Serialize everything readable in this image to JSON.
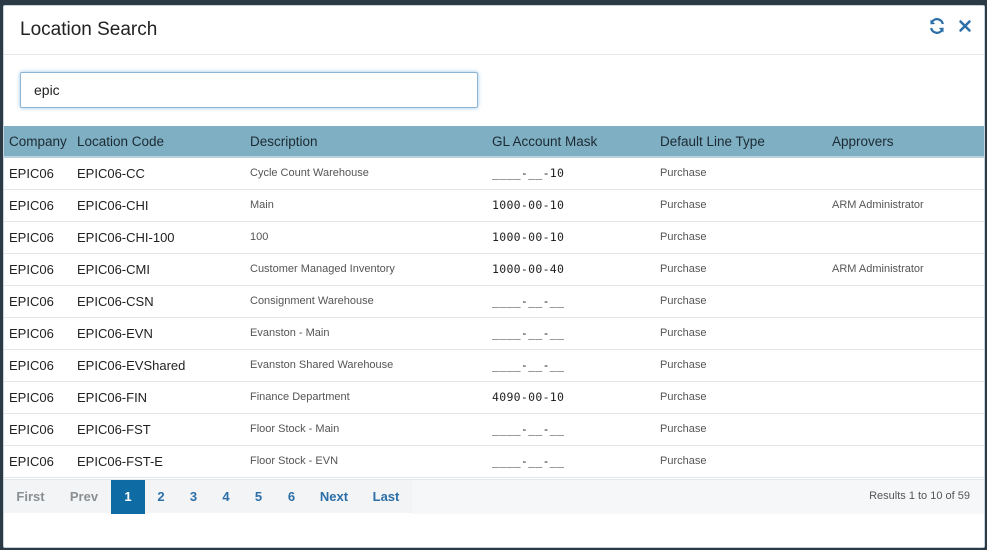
{
  "dialog": {
    "title": "Location Search"
  },
  "search": {
    "value": "epic"
  },
  "table": {
    "columns": [
      "Company",
      "Location Code",
      "Description",
      "GL Account Mask",
      "Default Line Type",
      "Approvers"
    ],
    "rows": [
      [
        "EPIC06",
        "EPIC06-CC",
        "Cycle Count Warehouse",
        "____-__-10",
        "Purchase",
        ""
      ],
      [
        "EPIC06",
        "EPIC06-CHI",
        "Main",
        "1000-00-10",
        "Purchase",
        "ARM Administrator"
      ],
      [
        "EPIC06",
        "EPIC06-CHI-100",
        "100",
        "1000-00-10",
        "Purchase",
        ""
      ],
      [
        "EPIC06",
        "EPIC06-CMI",
        "Customer Managed Inventory",
        "1000-00-40",
        "Purchase",
        "ARM Administrator"
      ],
      [
        "EPIC06",
        "EPIC06-CSN",
        "Consignment Warehouse",
        "____-__-__",
        "Purchase",
        ""
      ],
      [
        "EPIC06",
        "EPIC06-EVN",
        "Evanston - Main",
        "____-__-__",
        "Purchase",
        ""
      ],
      [
        "EPIC06",
        "EPIC06-EVShared",
        "Evanston Shared Warehouse",
        "____-__-__",
        "Purchase",
        ""
      ],
      [
        "EPIC06",
        "EPIC06-FIN",
        "Finance Department",
        "4090-00-10",
        "Purchase",
        ""
      ],
      [
        "EPIC06",
        "EPIC06-FST",
        "Floor Stock - Main",
        "____-__-__",
        "Purchase",
        ""
      ],
      [
        "EPIC06",
        "EPIC06-FST-E",
        "Floor Stock - EVN",
        "____-__-__",
        "Purchase",
        ""
      ]
    ]
  },
  "pager": {
    "first": "First",
    "prev": "Prev",
    "pages": [
      "1",
      "2",
      "3",
      "4",
      "5",
      "6"
    ],
    "current": "1",
    "next": "Next",
    "last": "Last",
    "results": "Results 1 to 10 of 59"
  },
  "icons": {
    "refresh": "refresh-icon",
    "close": "close-icon"
  },
  "colors": {
    "header_bg": "#7eafc3",
    "active_page": "#0f6ba3",
    "link": "#2c6fa8"
  }
}
